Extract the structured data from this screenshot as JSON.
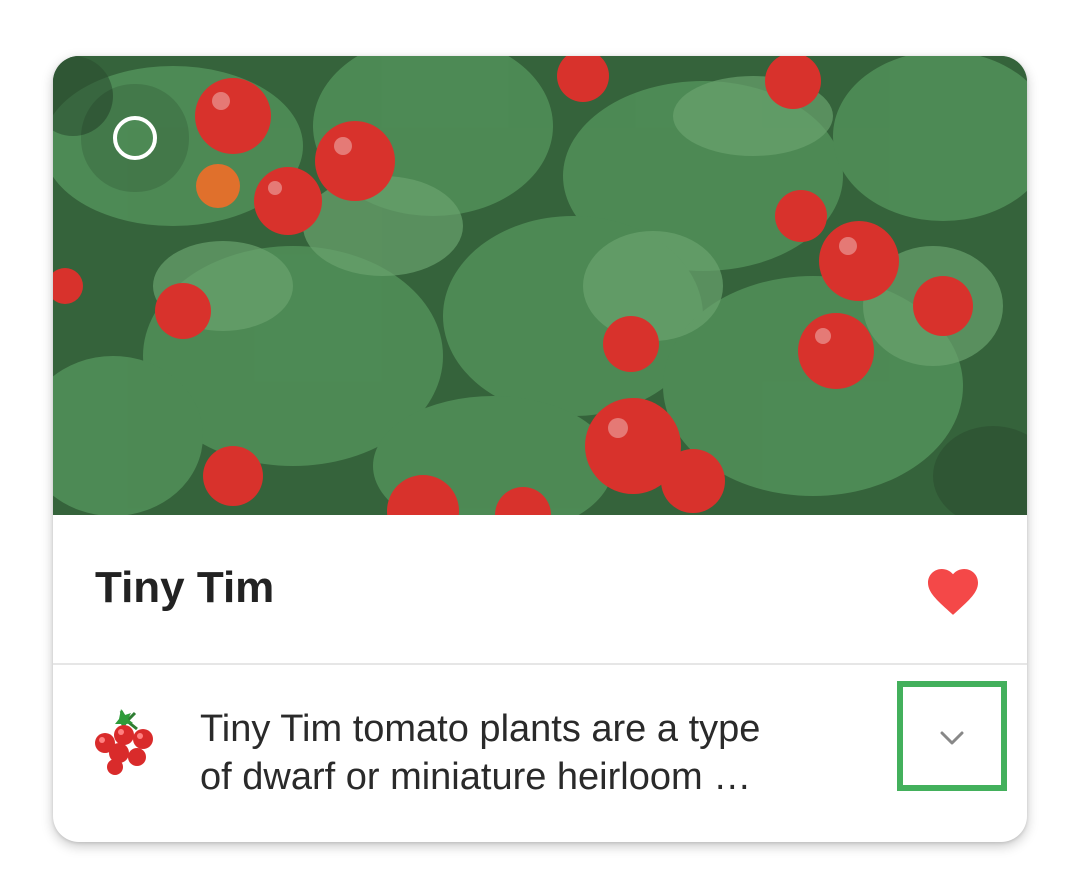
{
  "card": {
    "title": "Tiny Tim",
    "description_line1": "Tiny Tim tomato plants are a type",
    "description_line2": "of dwarf or miniature heirloom …",
    "favorite": true,
    "favorite_color": "#f44848",
    "highlight_color": "#43b05c",
    "photo_subject": "cherry tomato plant with red fruit and green leaves",
    "icons": {
      "select": "circle-outline-icon",
      "favorite": "heart-icon",
      "category": "cherry-tomatoes-icon",
      "expand": "chevron-down-icon"
    }
  }
}
